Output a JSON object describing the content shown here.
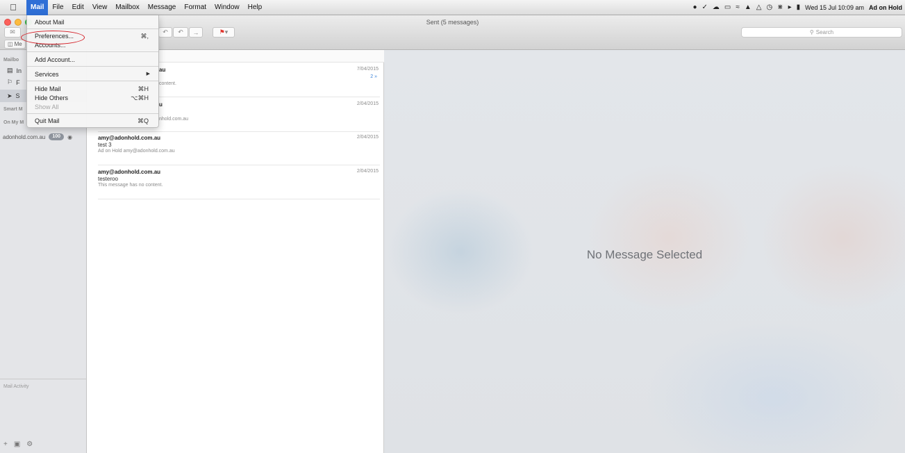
{
  "menubar": {
    "apple_icon": "apple-icon",
    "items": [
      "Mail",
      "File",
      "Edit",
      "View",
      "Mailbox",
      "Message",
      "Format",
      "Window",
      "Help"
    ],
    "clock": "Wed 15 Jul 10:09 am",
    "user": "Ad on Hold"
  },
  "window": {
    "title": "Sent (5 messages)",
    "search_placeholder": "Search",
    "mailboxes_button": "Me"
  },
  "app_menu": {
    "about": "About Mail",
    "preferences": "Preferences...",
    "preferences_shortcut": "⌘,",
    "accounts": "Accounts...",
    "add_account": "Add Account...",
    "services": "Services",
    "hide_mail": "Hide Mail",
    "hide_mail_shortcut": "⌘H",
    "hide_others": "Hide Others",
    "hide_others_shortcut": "⌥⌘H",
    "show_all": "Show All",
    "quit": "Quit Mail",
    "quit_shortcut": "⌘Q"
  },
  "sidebar": {
    "mailboxes_header": "Mailbo",
    "inbox_label": "In",
    "flagged_label": "F",
    "sent_label": "S",
    "smart_header": "Smart M",
    "on_my_mac_header": "On My M",
    "account_name": "adonhold.com.au",
    "account_badge": "100",
    "mail_activity": "Mail Activity"
  },
  "messages": [
    {
      "from": "au",
      "date": "7/04/2015",
      "subject": "",
      "preview": "content.",
      "thread_count": "2 »"
    },
    {
      "from": "u",
      "date": "2/04/2015",
      "subject": "",
      "preview": "nhold.com.au"
    },
    {
      "from": "amy@adonhold.com.au",
      "date": "2/04/2015",
      "subject": "test 3",
      "preview": "Ad on Hold amy@adonhold.com.au"
    },
    {
      "from": "amy@adonhold.com.au",
      "date": "2/04/2015",
      "subject": "testeroo",
      "preview": "This message has no content."
    }
  ],
  "preview": {
    "empty_text": "No Message Selected"
  },
  "colors": {
    "menu_highlight": "#2f6fd6",
    "annotation_circle": "#d41c24",
    "flag": "#e0332b"
  }
}
